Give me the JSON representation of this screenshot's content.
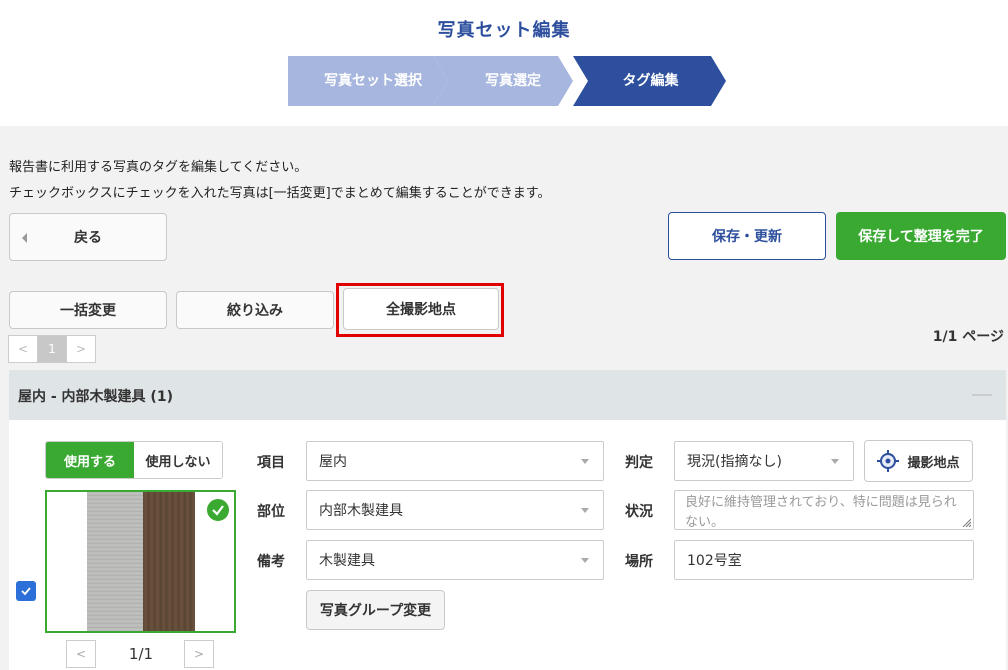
{
  "header": {
    "title": "写真セット編集"
  },
  "steps": [
    {
      "label": "写真セット選択",
      "state": "done"
    },
    {
      "label": "写真選定",
      "state": "done"
    },
    {
      "label": "タグ編集",
      "state": "current"
    }
  ],
  "instructions": {
    "line1": "報告書に利用する写真のタグを編集してください。",
    "line2": "チェックボックスにチェックを入れた写真は[一括変更]でまとめて編集することができます。"
  },
  "toolbar": {
    "back_label": "戻る",
    "save_label": "保存・更新",
    "finish_label": "保存して整理を完了",
    "bulk_label": "一括変更",
    "filter_label": "絞り込み",
    "all_locations_label": "全撮影地点"
  },
  "pagination": {
    "info": "1/1 ページ",
    "prev": "<",
    "current": "1",
    "next": ">"
  },
  "group": {
    "title": "屋内 - 内部木製建具 (1)"
  },
  "photo_card": {
    "use_label": "使用する",
    "not_use_label": "使用しない",
    "selected": true,
    "photo_counter": "1/1",
    "prev": "<",
    "next": ">",
    "fields": {
      "item_label": "項目",
      "item_value": "屋内",
      "part_label": "部位",
      "part_value": "内部木製建具",
      "note_label": "備考",
      "note_value": "木製建具",
      "judge_label": "判定",
      "judge_value": "現況(指摘なし)",
      "status_label": "状況",
      "status_value": "良好に維持管理されており、特に問題は見られない。",
      "place_label": "場所",
      "place_value": "102号室"
    },
    "location_button_label": "撮影地点",
    "group_change_label": "写真グループ変更"
  },
  "colors": {
    "brand_blue": "#2d4f9e",
    "step_light": "#a7b6de",
    "accent_green": "#3aa932",
    "highlight_red": "#e00000"
  }
}
